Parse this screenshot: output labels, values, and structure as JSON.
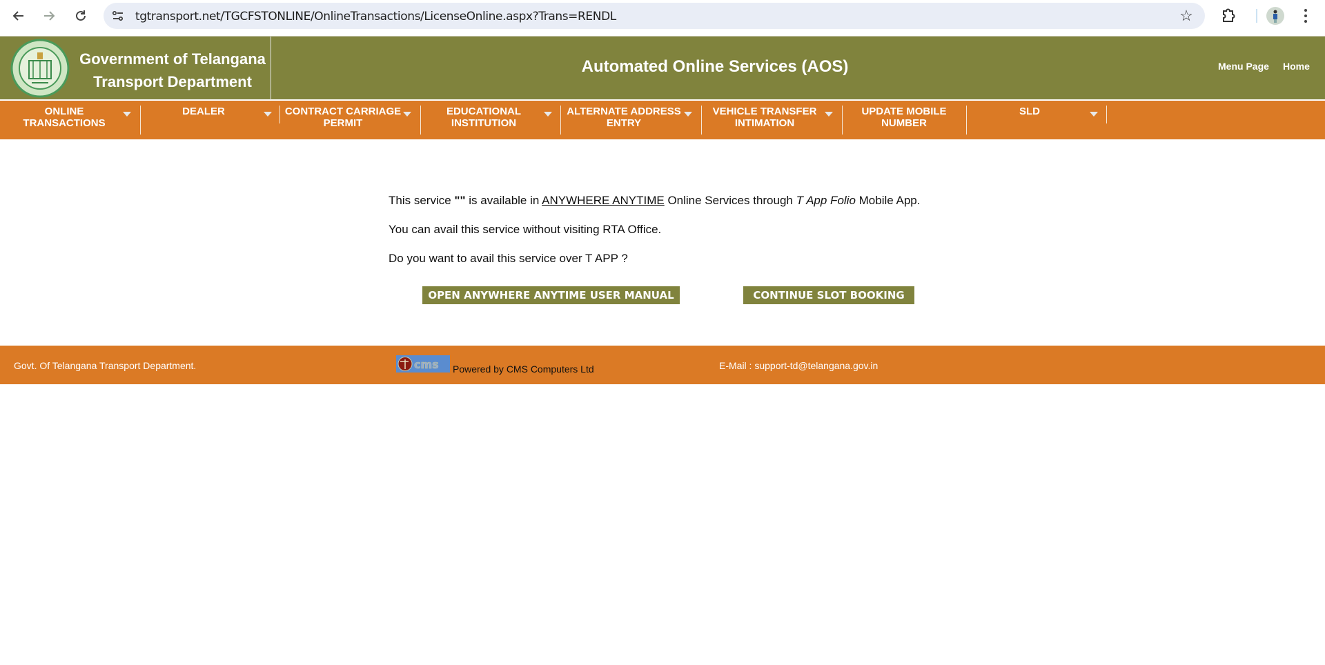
{
  "browser": {
    "url": "tgtransport.net/TGCFSTONLINE/OnlineTransactions/LicenseOnline.aspx?Trans=RENDL",
    "icons": [
      "back-arrow-icon",
      "forward-arrow-icon",
      "reload-icon",
      "site-info-icon",
      "bookmark-star-icon",
      "extensions-icon",
      "profile-avatar",
      "more-menu-icon"
    ]
  },
  "header": {
    "gov_line1": "Government of Telangana",
    "gov_line2": "Transport Department",
    "title": "Automated Online Services (AOS)",
    "links": {
      "menu_page": "Menu Page",
      "home": "Home"
    }
  },
  "menu": {
    "items": [
      {
        "line1": "ONLINE",
        "line2": "TRANSACTIONS",
        "has_dropdown": true
      },
      {
        "line1": "DEALER",
        "line2": "",
        "has_dropdown": true
      },
      {
        "line1": "CONTRACT CARRIAGE",
        "line2": "PERMIT",
        "has_dropdown": true
      },
      {
        "line1": "EDUCATIONAL",
        "line2": "INSTITUTION",
        "has_dropdown": true
      },
      {
        "line1": "ALTERNATE ADDRESS",
        "line2": "ENTRY",
        "has_dropdown": true
      },
      {
        "line1": "VEHICLE TRANSFER",
        "line2": "INTIMATION",
        "has_dropdown": true
      },
      {
        "line1": "UPDATE MOBILE",
        "line2": "NUMBER",
        "has_dropdown": false
      },
      {
        "line1": "SLD",
        "line2": "",
        "has_dropdown": true
      }
    ]
  },
  "content": {
    "p1": {
      "a": "This service ",
      "quote": "\"\"",
      "b": " is available in ",
      "link": "ANYWHERE ANYTIME",
      "c": " Online Services through ",
      "app": "T App Folio",
      "d": " Mobile App."
    },
    "p2": "You can avail this service without visiting RTA Office.",
    "p3": "Do you want to avail this service over T APP ?",
    "buttons": {
      "manual": "OPEN ANYWHERE ANYTIME USER MANUAL",
      "continue": "CONTINUE SLOT BOOKING"
    }
  },
  "footer": {
    "gov": "Govt. Of Telangana Transport Department.",
    "powered": "Powered by CMS Computers Ltd",
    "email": "E-Mail : support-td@telangana.gov.in"
  },
  "colors": {
    "header_olive": "#80833d",
    "menu_orange": "#db7a25",
    "button_olive": "#80833d"
  }
}
